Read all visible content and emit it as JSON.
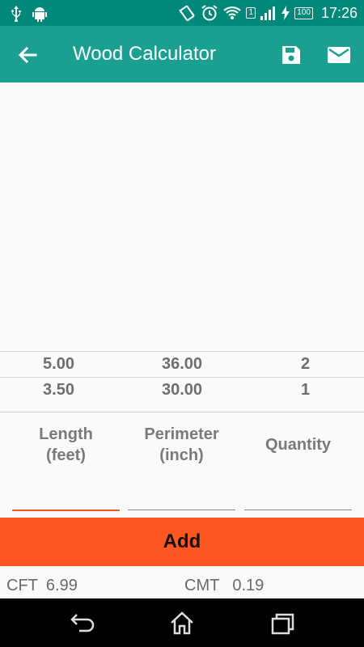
{
  "status_bar": {
    "battery": "100",
    "sim": "1",
    "time": "17:26",
    "icons": [
      "usb-icon",
      "android-icon",
      "vibrate-icon",
      "alarm-icon",
      "wifi-icon",
      "sim-icon",
      "signal-icon",
      "charging-icon",
      "battery-icon"
    ]
  },
  "app_bar": {
    "title": "Wood Calculator",
    "icons": [
      "back-arrow-icon",
      "save-icon",
      "mail-icon"
    ]
  },
  "entries": [
    {
      "length": "5.00",
      "perimeter": "36.00",
      "quantity": "2"
    },
    {
      "length": "3.50",
      "perimeter": "30.00",
      "quantity": "1"
    }
  ],
  "inputs": {
    "length_label_1": "Length",
    "length_label_2": "(feet)",
    "length_value": "",
    "perimeter_label_1": "Perimeter",
    "perimeter_label_2": "(inch)",
    "perimeter_value": "",
    "quantity_label": "Quantity",
    "quantity_value": ""
  },
  "add_button": "Add",
  "results": {
    "cft_label": "CFT",
    "cft_value": "6.99",
    "cmt_label": "CMT",
    "cmt_value": "0.19"
  },
  "colors": {
    "status_bar": "#00897b",
    "app_bar": "#1aa091",
    "accent": "#ff5722"
  },
  "nav_bar": {
    "icons": [
      "back-icon",
      "home-icon",
      "recents-icon"
    ]
  }
}
